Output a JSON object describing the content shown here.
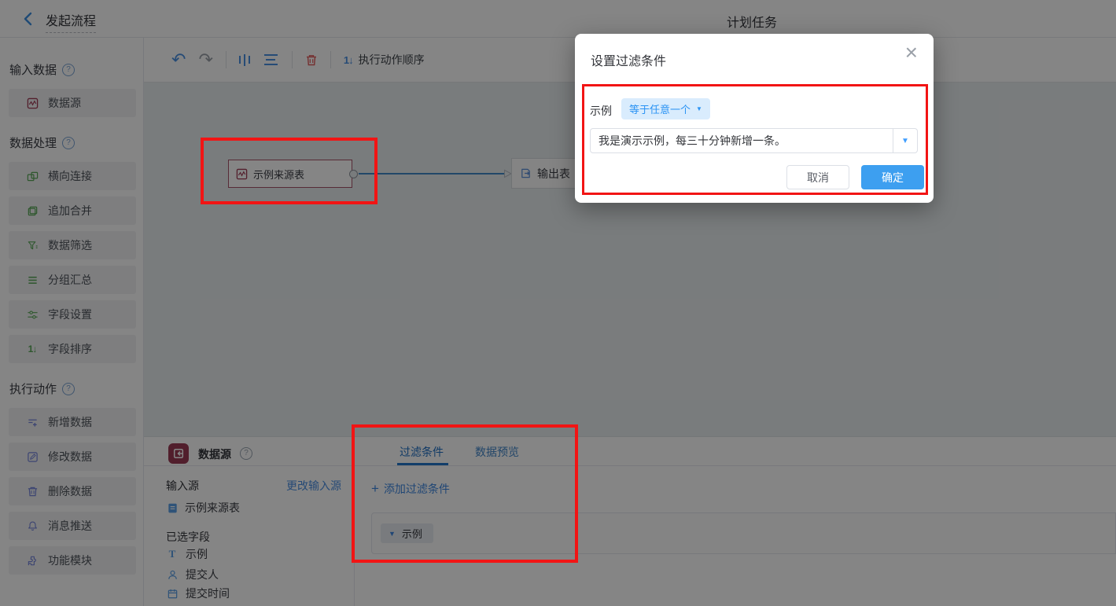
{
  "topbar": {
    "back_label": "发起流程",
    "title": "计划任务"
  },
  "toolbar": {
    "order_label": "执行动作顺序"
  },
  "sidebar": {
    "sections": [
      {
        "label": "输入数据"
      },
      {
        "label": "数据处理"
      },
      {
        "label": "执行动作"
      }
    ],
    "input_items": [
      {
        "label": "数据源"
      }
    ],
    "process_items": [
      {
        "label": "横向连接"
      },
      {
        "label": "追加合并"
      },
      {
        "label": "数据筛选"
      },
      {
        "label": "分组汇总"
      },
      {
        "label": "字段设置"
      },
      {
        "label": "字段排序"
      }
    ],
    "action_items": [
      {
        "label": "新增数据"
      },
      {
        "label": "修改数据"
      },
      {
        "label": "删除数据"
      },
      {
        "label": "消息推送"
      },
      {
        "label": "功能模块"
      }
    ]
  },
  "canvas": {
    "source_node_label": "示例来源表",
    "output_node_label": "输出表"
  },
  "panel": {
    "header_title": "数据源",
    "input_source_label": "输入源",
    "change_input_source": "更改输入源",
    "source_table": "示例来源表",
    "selected_fields_label": "已选字段",
    "fields": [
      {
        "label": "示例"
      },
      {
        "label": "提交人"
      },
      {
        "label": "提交时间"
      }
    ],
    "tabs": [
      {
        "label": "过滤条件"
      },
      {
        "label": "数据预览"
      }
    ],
    "add_filter": "添加过滤条件",
    "filter_pill": "示例"
  },
  "modal": {
    "title": "设置过滤条件",
    "field_label": "示例",
    "operator": "等于任意一个",
    "value": "我是演示示例，每三十分钟新增一条。",
    "cancel": "取消",
    "confirm": "确定"
  },
  "icons": {
    "undo": "↶",
    "redo": "↷",
    "caret_down": "▼",
    "close": "×",
    "question": "?",
    "order_glyph": "1↓",
    "plus": "+",
    "text_field_glyph": "T"
  },
  "colors": {
    "accent_blue": "#409eff",
    "datasource_red": "#9c3b55",
    "process_green": "#58a857",
    "action_blue": "#7584db",
    "annotation_red": "#f21414",
    "confirm_blue": "#3d9ff0",
    "tab_active_blue": "#1f6fc4"
  }
}
